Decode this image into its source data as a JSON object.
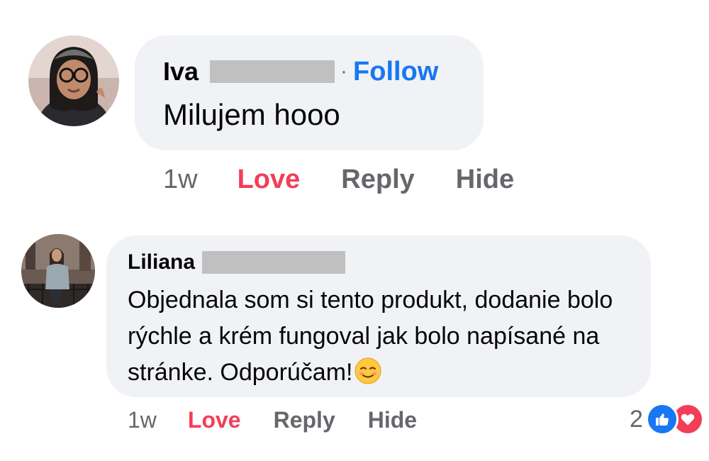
{
  "comments": [
    {
      "author": "Iva",
      "follow_label": "Follow",
      "separator": "·",
      "text": "Milujem hooo",
      "time": "1w",
      "actions": {
        "love": "Love",
        "reply": "Reply",
        "hide": "Hide"
      }
    },
    {
      "author": "Liliana",
      "text": "Objednala som si tento produkt, dodanie bolo rýchle a krém fungoval jak bolo napísané na stránke. Odporúčam!",
      "emoji": "relieved-smile-emoji",
      "time": "1w",
      "actions": {
        "love": "Love",
        "reply": "Reply",
        "hide": "Hide"
      },
      "reactions": {
        "count": "2",
        "types": [
          "like-icon",
          "heart-icon"
        ]
      }
    }
  ],
  "colors": {
    "bubble": "#f0f2f5",
    "link": "#1877f2",
    "love": "#f33e58",
    "secondary_text": "#65676b"
  }
}
